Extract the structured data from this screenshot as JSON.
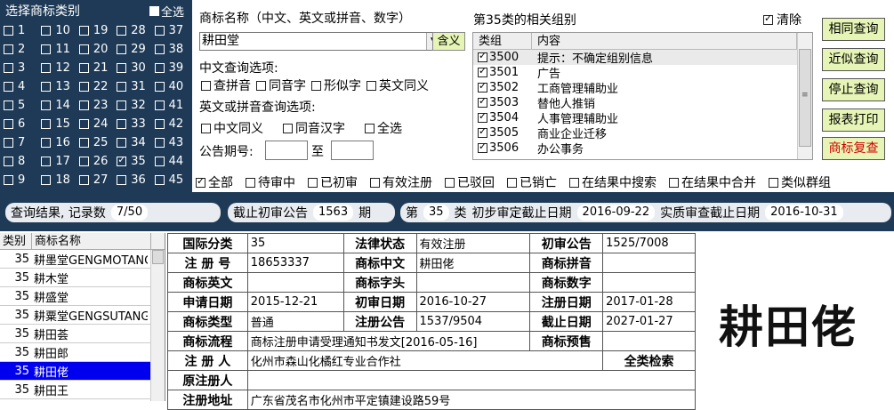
{
  "category_panel": {
    "title": "选择商标类别",
    "select_all": "全选",
    "rows": [
      [
        {
          "n": "1",
          "c": false
        },
        {
          "n": "10",
          "c": false
        },
        {
          "n": "19",
          "c": false
        },
        {
          "n": "28",
          "c": false
        },
        {
          "n": "37",
          "c": false
        }
      ],
      [
        {
          "n": "2",
          "c": false
        },
        {
          "n": "11",
          "c": false
        },
        {
          "n": "20",
          "c": false
        },
        {
          "n": "29",
          "c": false
        },
        {
          "n": "38",
          "c": false
        }
      ],
      [
        {
          "n": "3",
          "c": false
        },
        {
          "n": "12",
          "c": false
        },
        {
          "n": "21",
          "c": false
        },
        {
          "n": "30",
          "c": false
        },
        {
          "n": "39",
          "c": false
        }
      ],
      [
        {
          "n": "4",
          "c": false
        },
        {
          "n": "13",
          "c": false
        },
        {
          "n": "22",
          "c": false
        },
        {
          "n": "31",
          "c": false
        },
        {
          "n": "40",
          "c": false
        }
      ],
      [
        {
          "n": "5",
          "c": false
        },
        {
          "n": "14",
          "c": false
        },
        {
          "n": "23",
          "c": false
        },
        {
          "n": "32",
          "c": false
        },
        {
          "n": "41",
          "c": false
        }
      ],
      [
        {
          "n": "6",
          "c": false
        },
        {
          "n": "15",
          "c": false
        },
        {
          "n": "24",
          "c": false
        },
        {
          "n": "33",
          "c": false
        },
        {
          "n": "42",
          "c": false
        }
      ],
      [
        {
          "n": "7",
          "c": false
        },
        {
          "n": "16",
          "c": false
        },
        {
          "n": "25",
          "c": false
        },
        {
          "n": "34",
          "c": false
        },
        {
          "n": "43",
          "c": false
        }
      ],
      [
        {
          "n": "8",
          "c": false
        },
        {
          "n": "17",
          "c": false
        },
        {
          "n": "26",
          "c": false
        },
        {
          "n": "35",
          "c": true
        },
        {
          "n": "44",
          "c": false
        }
      ],
      [
        {
          "n": "9",
          "c": false
        },
        {
          "n": "18",
          "c": false
        },
        {
          "n": "27",
          "c": false
        },
        {
          "n": "36",
          "c": false
        },
        {
          "n": "45",
          "c": false
        }
      ]
    ]
  },
  "query": {
    "name_label": "商标名称（中文、英文或拼音、数字）",
    "name_value": "耕田堂",
    "meaning_button": "含义",
    "cn_options_label": "中文查询选项:",
    "cn_options": [
      "查拼音",
      "同音字",
      "形似字",
      "英文同义"
    ],
    "en_options_label": "英文或拼音查询选项:",
    "en_options": [
      "中文同义",
      "同音汉字",
      "全选"
    ],
    "pub_label": "公告期号:",
    "pub_to": "至"
  },
  "groups": {
    "title": "第35类的相关组别",
    "clear_label": "清除",
    "col_group": "类组",
    "col_content": "内容",
    "rows": [
      {
        "code": "3500",
        "text": "提示：不确定组别信息"
      },
      {
        "code": "3501",
        "text": "广告"
      },
      {
        "code": "3502",
        "text": "工商管理辅助业"
      },
      {
        "code": "3503",
        "text": "替他人推销"
      },
      {
        "code": "3504",
        "text": "人事管理辅助业"
      },
      {
        "code": "3505",
        "text": "商业企业迁移"
      },
      {
        "code": "3506",
        "text": "办公事务"
      }
    ]
  },
  "actions": {
    "search": "相同查询",
    "near": "近似查询",
    "stop": "停止查询",
    "report": "报表打印",
    "recheck": "商标复查"
  },
  "filters": [
    {
      "label": "全部",
      "checked": true
    },
    {
      "label": "待审中",
      "checked": false
    },
    {
      "label": "已初审",
      "checked": false
    },
    {
      "label": "有效注册",
      "checked": false
    },
    {
      "label": "已驳回",
      "checked": false
    },
    {
      "label": "已销亡",
      "checked": false
    },
    {
      "label": "在结果中搜索",
      "checked": false
    },
    {
      "label": "在结果中合并",
      "checked": false
    },
    {
      "label": "类似群组",
      "checked": false
    }
  ],
  "status": {
    "result_label": "查询结果, 记录数",
    "result_count": "7/50",
    "deadline_label": "截止初审公告",
    "deadline_value": "1563",
    "deadline_unit": "期",
    "class_prefix": "第",
    "class_value": "35",
    "class_suffix": "类",
    "prelim_label": "初步审定截止日期",
    "prelim_date": "2016-09-22",
    "subst_label": "实质审查截止日期",
    "subst_date": "2016-10-31"
  },
  "list": {
    "col_class": "类别",
    "col_name": "商标名称",
    "rows": [
      {
        "cls": "35",
        "name": "耕墨堂GENGMOTANG",
        "sel": false
      },
      {
        "cls": "35",
        "name": "耕木堂",
        "sel": false
      },
      {
        "cls": "35",
        "name": "耕盛堂",
        "sel": false
      },
      {
        "cls": "35",
        "name": "耕粟堂GENGSUTANG",
        "sel": false
      },
      {
        "cls": "35",
        "name": "耕田荟",
        "sel": false
      },
      {
        "cls": "35",
        "name": "耕田郎",
        "sel": false
      },
      {
        "cls": "35",
        "name": "耕田佬",
        "sel": true
      },
      {
        "cls": "35",
        "name": "耕田王",
        "sel": false
      }
    ]
  },
  "detail": {
    "intl_class_k": "国际分类",
    "intl_class_v": "35",
    "legal_k": "法律状态",
    "legal_v": "有效注册",
    "prelim_k": "初审公告",
    "prelim_v": "1525/7008",
    "reg_no_k": "注 册 号",
    "reg_no_v": "18653337",
    "name_cn_k": "商标中文",
    "name_cn_v": "耕田佬",
    "pinyin_k": "商标拼音",
    "pinyin_v": "",
    "name_en_k": "商标英文",
    "name_en_v": "",
    "head_k": "商标字头",
    "head_v": "",
    "digit_k": "商标数字",
    "digit_v": "",
    "apply_k": "申请日期",
    "apply_v": "2015-12-21",
    "prelim_date_k": "初审日期",
    "prelim_date_v": "2016-10-27",
    "reg_date_k": "注册日期",
    "reg_date_v": "2017-01-28",
    "type_k": "商标类型",
    "type_v": "普通",
    "reg_pub_k": "注册公告",
    "reg_pub_v": "1537/9504",
    "expire_k": "截止日期",
    "expire_v": "2027-01-27",
    "flow_k": "商标流程",
    "flow_v": "商标注册申请受理通知书发文[2016-05-16]",
    "preview_k": "商标预售",
    "preview_v": "",
    "registrant_k": "注 册 人",
    "registrant_v": "化州市森山化橘红专业合作社",
    "all_class_search": "全类检索",
    "orig_reg_k": "原注册人",
    "orig_reg_v": "",
    "address_k": "注册地址",
    "address_v": "广东省茂名市化州市平定镇建设路59号"
  },
  "logo": {
    "text": "耕田佬"
  },
  "colors": {
    "panel_dark": "#1e3a57",
    "button_green": "#e6f5b5",
    "selection_blue": "#0000ee",
    "recheck_red": "#d00000"
  }
}
